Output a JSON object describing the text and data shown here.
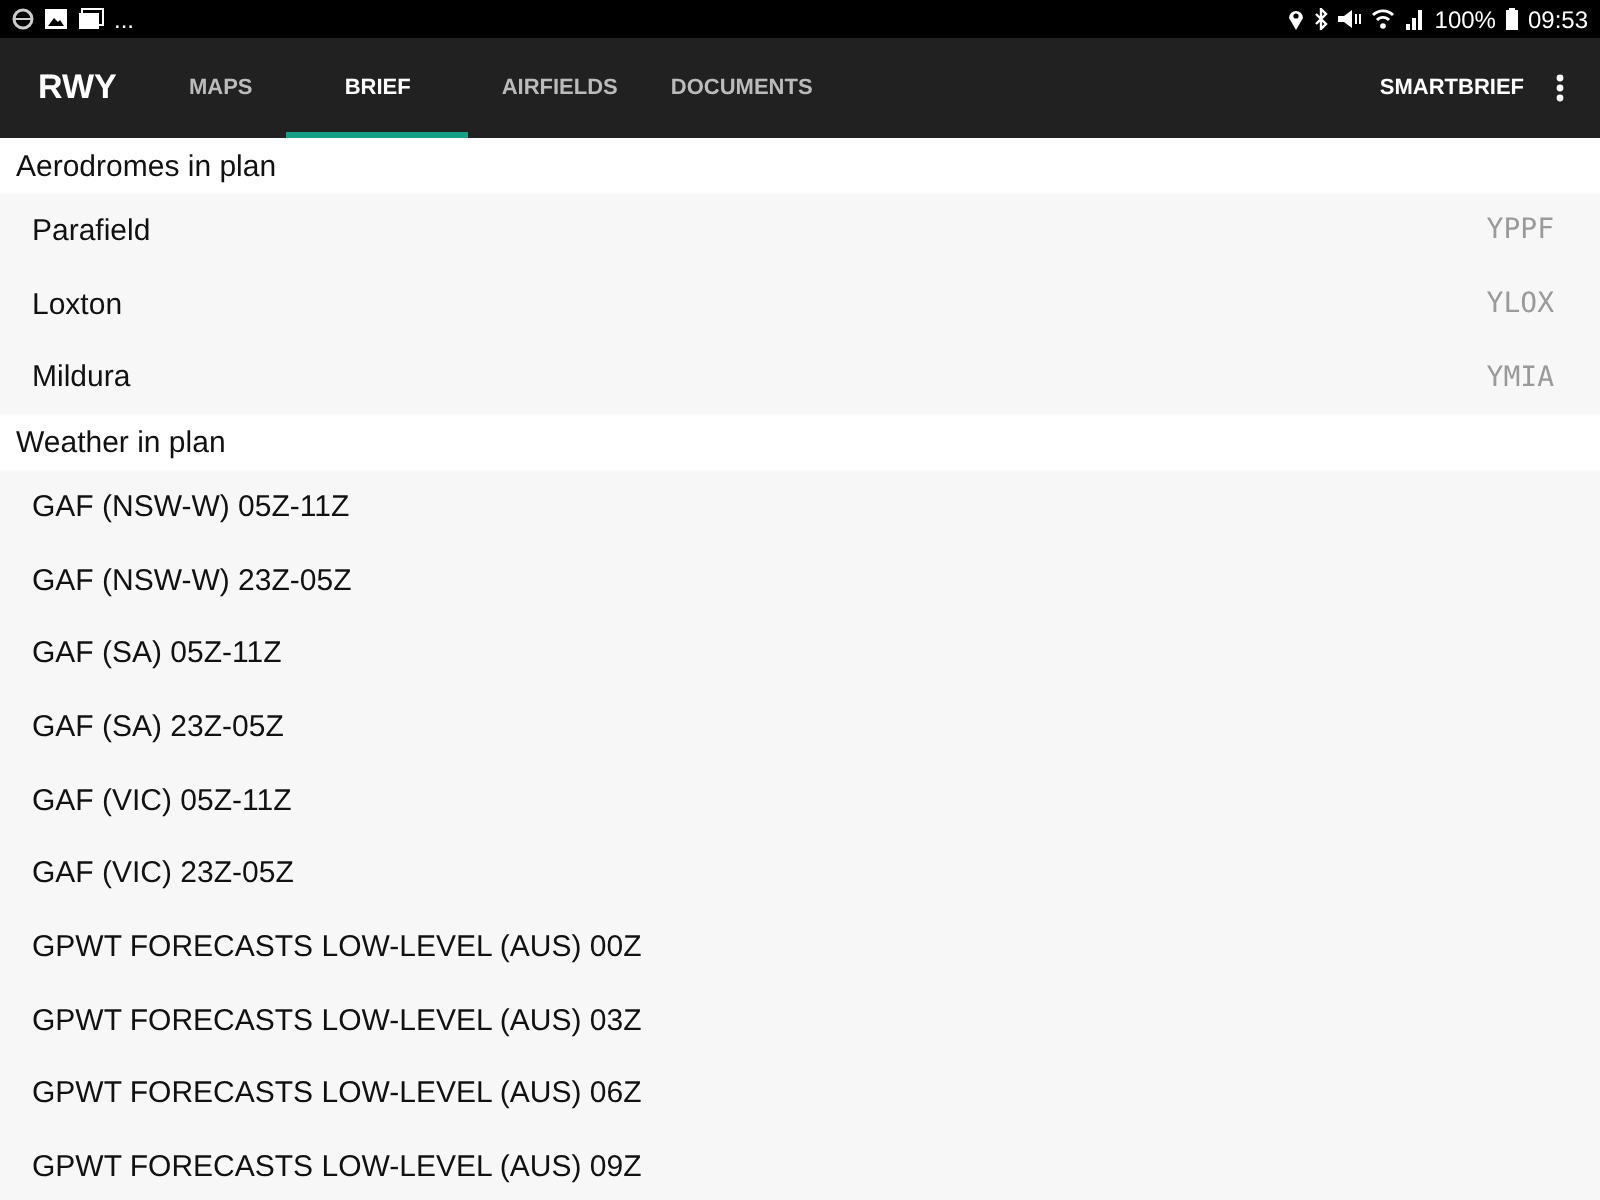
{
  "status_bar": {
    "overflow": "...",
    "battery": "100%",
    "time": "09:53"
  },
  "app_bar": {
    "title": "RWY",
    "tabs": [
      {
        "label": "MAPS",
        "selected": false
      },
      {
        "label": "BRIEF",
        "selected": true
      },
      {
        "label": "AIRFIELDS",
        "selected": false
      },
      {
        "label": "DOCUMENTS",
        "selected": false
      }
    ],
    "action": "SMARTBRIEF"
  },
  "sections": [
    {
      "title": "Aerodromes in plan",
      "items": [
        {
          "name": "Parafield",
          "code": "YPPF"
        },
        {
          "name": "Loxton",
          "code": "YLOX"
        },
        {
          "name": "Mildura",
          "code": "YMIA"
        }
      ]
    },
    {
      "title": "Weather in plan",
      "items": [
        {
          "name": "GAF (NSW-W) 05Z-11Z"
        },
        {
          "name": "GAF (NSW-W) 23Z-05Z"
        },
        {
          "name": "GAF (SA) 05Z-11Z"
        },
        {
          "name": "GAF (SA) 23Z-05Z"
        },
        {
          "name": "GAF (VIC) 05Z-11Z"
        },
        {
          "name": "GAF (VIC) 23Z-05Z"
        },
        {
          "name": "GPWT FORECASTS LOW-LEVEL (AUS) 00Z"
        },
        {
          "name": "GPWT FORECASTS LOW-LEVEL (AUS) 03Z"
        },
        {
          "name": "GPWT FORECASTS LOW-LEVEL (AUS) 06Z"
        },
        {
          "name": "GPWT FORECASTS LOW-LEVEL (AUS) 09Z"
        }
      ]
    }
  ]
}
